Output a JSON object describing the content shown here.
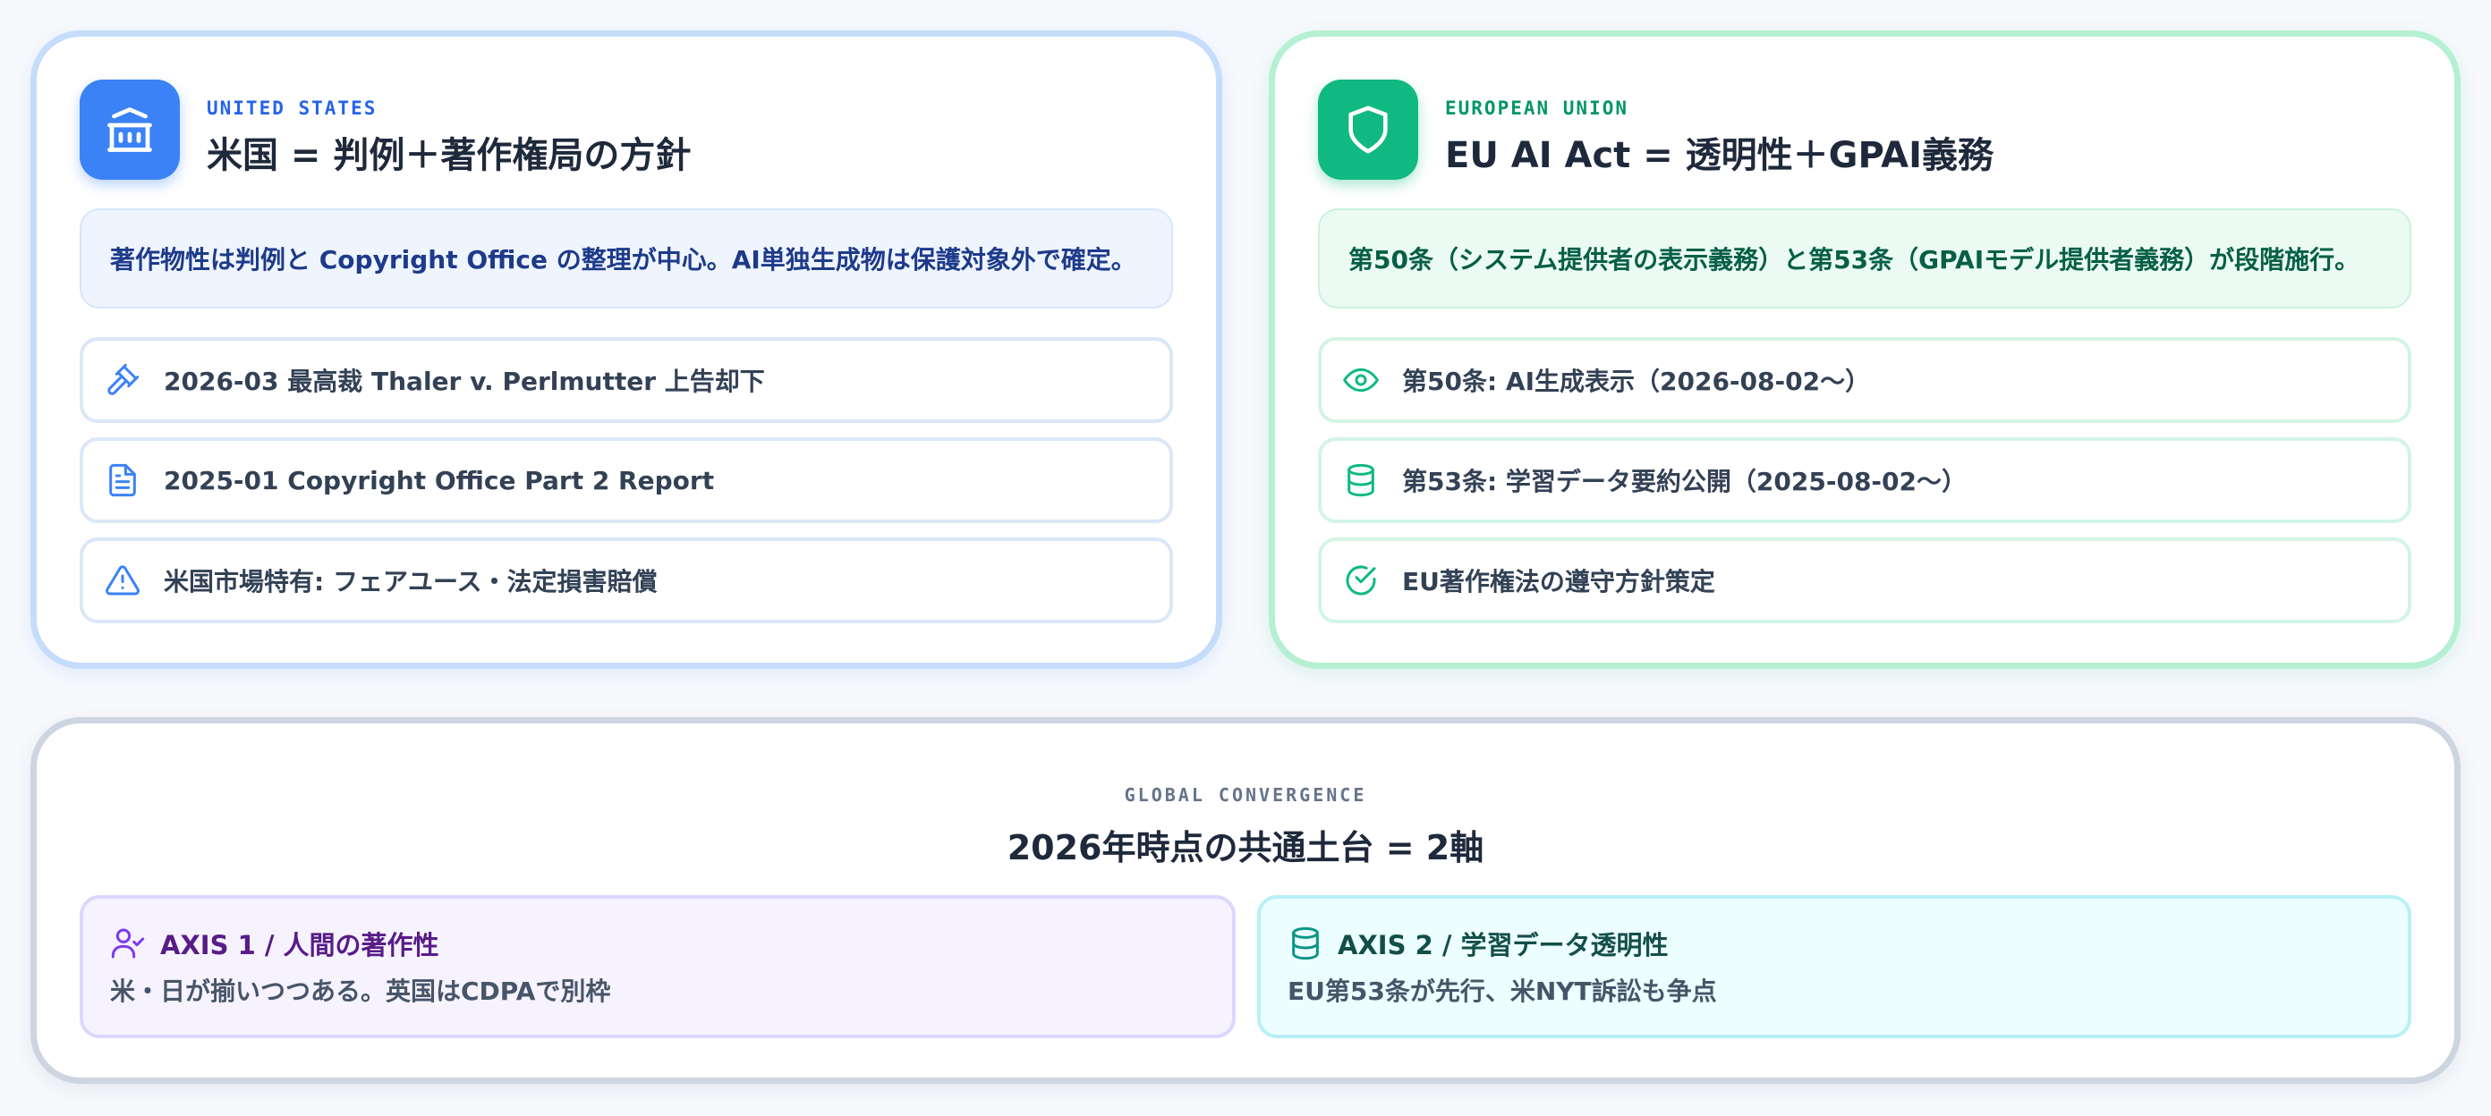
{
  "us": {
    "eyebrow": "UNITED STATES",
    "title": "米国 = 判例＋著作権局の方針",
    "summary": "著作物性は判例と Copyright Office の整理が中心。AI単独生成物は保護対象外で確定。",
    "icon": "bank-icon",
    "items": [
      {
        "icon": "gavel-icon",
        "text": "2026-03 最高裁 Thaler v. Perlmutter 上告却下"
      },
      {
        "icon": "document-icon",
        "text": "2025-01 Copyright Office Part 2 Report"
      },
      {
        "icon": "warning-icon",
        "text": "米国市場特有: フェアユース・法定損害賠償"
      }
    ]
  },
  "eu": {
    "eyebrow": "EUROPEAN UNION",
    "title": "EU AI Act = 透明性＋GPAI義務",
    "summary": "第50条（システム提供者の表示義務）と第53条（GPAIモデル提供者義務）が段階施行。",
    "icon": "shield-icon",
    "items": [
      {
        "icon": "eye-icon",
        "text": "第50条: AI生成表示（2026-08-02〜）"
      },
      {
        "icon": "database-icon",
        "text": "第53条: 学習データ要約公開（2025-08-02〜）"
      },
      {
        "icon": "check-circle-icon",
        "text": "EU著作権法の遵守方針策定"
      }
    ]
  },
  "global": {
    "eyebrow": "GLOBAL CONVERGENCE",
    "title": "2026年時点の共通土台 = 2軸",
    "axes": [
      {
        "icon": "user-check-icon",
        "label": "AXIS 1 / 人間の著作性",
        "desc": "米・日が揃いつつある。英国はCDPAで別枠"
      },
      {
        "icon": "database-icon",
        "label": "AXIS 2 / 学習データ透明性",
        "desc": "EU第53条が先行、米NYT訴訟も争点"
      }
    ]
  },
  "colors": {
    "us_accent": "#3b82f6",
    "eu_accent": "#10b981",
    "axis1_accent": "#7c3aed",
    "axis2_accent": "#0d9488"
  }
}
